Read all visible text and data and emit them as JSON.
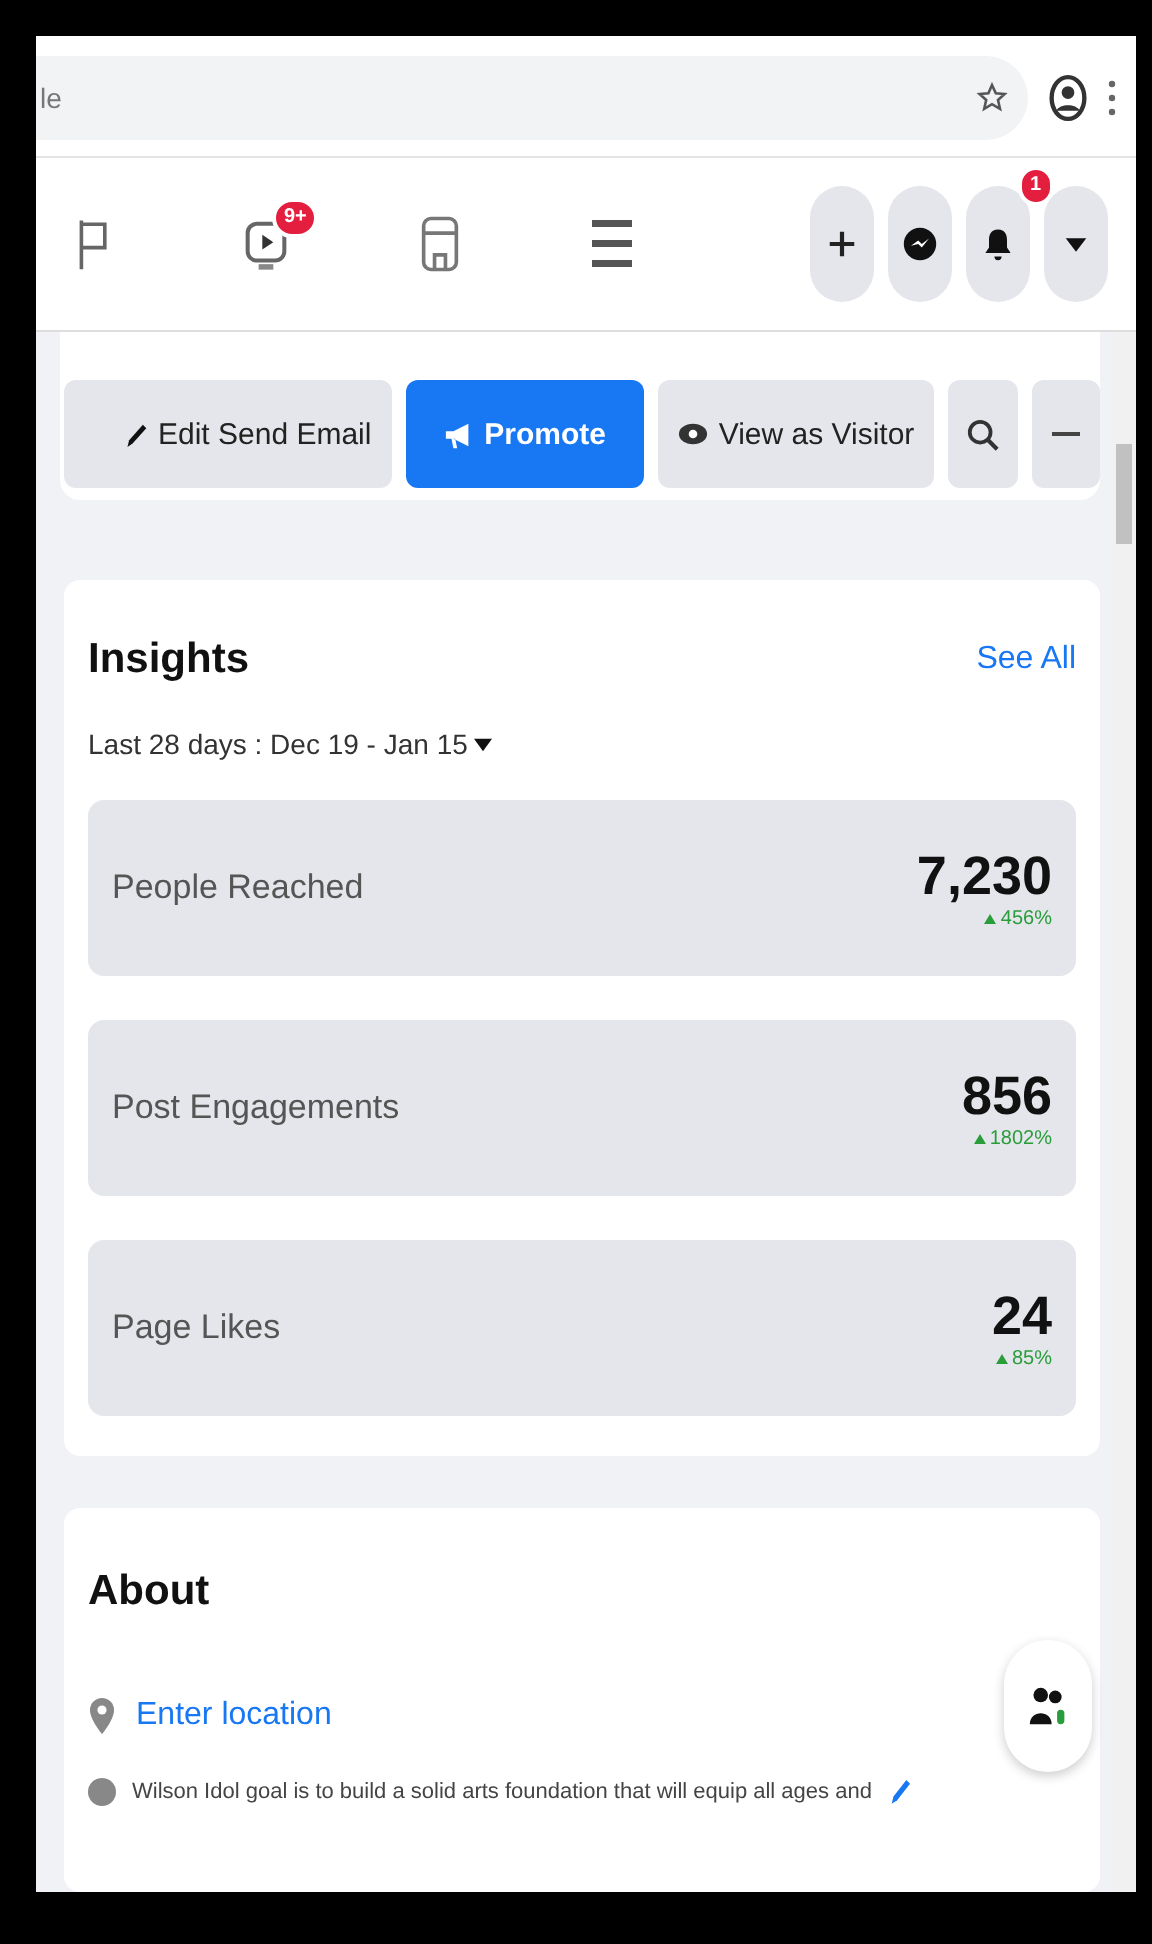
{
  "address_bar": {
    "url": "le"
  },
  "nav": {
    "tabs": [
      {
        "kind": "flag"
      },
      {
        "kind": "video",
        "badge": "9+"
      },
      {
        "kind": "store"
      },
      {
        "kind": "menu"
      }
    ],
    "actions": [
      {
        "kind": "plus"
      },
      {
        "kind": "messenger"
      },
      {
        "kind": "bell",
        "badge": "1"
      },
      {
        "kind": "caret"
      }
    ]
  },
  "page_actions": [
    {
      "kind": "edit",
      "label": "Edit Send Email",
      "primary": false
    },
    {
      "kind": "promote",
      "label": "Promote",
      "primary": true
    },
    {
      "kind": "visitor",
      "label": "View as Visitor",
      "primary": false
    },
    {
      "kind": "search",
      "primary": false
    },
    {
      "kind": "more",
      "primary": false
    }
  ],
  "insights": {
    "title": "Insights",
    "see_all": "See All",
    "range": "Last 28 days : Dec 19 - Jan 15",
    "metrics": [
      {
        "label": "People Reached",
        "value": "7,230",
        "change": "456%"
      },
      {
        "label": "Post Engagements",
        "value": "856",
        "change": "1802%"
      },
      {
        "label": "Page Likes",
        "value": "24",
        "change": "85%"
      }
    ]
  },
  "about": {
    "title": "About",
    "location": "Enter location",
    "description": "Wilson Idol goal is to build a solid arts foundation that will equip all ages and"
  }
}
